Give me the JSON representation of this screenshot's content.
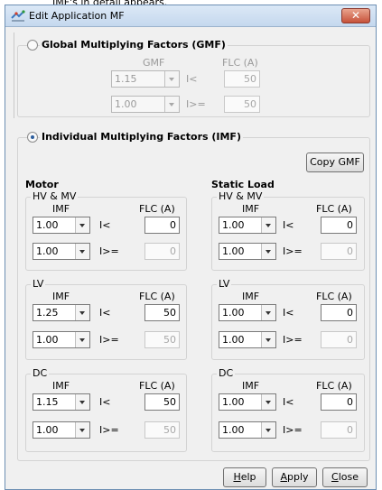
{
  "top_caption": "IMF's in detail appears.",
  "window": {
    "title": "Edit Application MF",
    "close_glyph": "✕"
  },
  "gmf_section": {
    "legend": "Global Multiplying Factors (GMF)",
    "col_gmf": "GMF",
    "col_flc": "FLC (A)",
    "rows": [
      {
        "value": "1.15",
        "op": "I<",
        "flc": "50"
      },
      {
        "value": "1.00",
        "op": "I>=",
        "flc": "50"
      }
    ]
  },
  "imf_section": {
    "legend": "Individual Multiplying Factors (IMF)",
    "copy_button": "Copy GMF"
  },
  "motor": {
    "heading": "Motor",
    "groups": [
      {
        "title": "HV & MV",
        "col_imf": "IMF",
        "col_flc": "FLC (A)",
        "rows": [
          {
            "value": "1.00",
            "op": "I<",
            "flc": "0"
          },
          {
            "value": "1.00",
            "op": "I>=",
            "flc": "0"
          }
        ]
      },
      {
        "title": "LV",
        "col_imf": "IMF",
        "col_flc": "FLC (A)",
        "rows": [
          {
            "value": "1.25",
            "op": "I<",
            "flc": "50"
          },
          {
            "value": "1.00",
            "op": "I>=",
            "flc": "50"
          }
        ]
      },
      {
        "title": "DC",
        "col_imf": "IMF",
        "col_flc": "FLC (A)",
        "rows": [
          {
            "value": "1.15",
            "op": "I<",
            "flc": "50"
          },
          {
            "value": "1.00",
            "op": "I>=",
            "flc": "50"
          }
        ]
      }
    ]
  },
  "static_load": {
    "heading": "Static Load",
    "groups": [
      {
        "title": "HV & MV",
        "col_imf": "IMF",
        "col_flc": "FLC (A)",
        "rows": [
          {
            "value": "1.00",
            "op": "I<",
            "flc": "0"
          },
          {
            "value": "1.00",
            "op": "I>=",
            "flc": "0"
          }
        ]
      },
      {
        "title": "LV",
        "col_imf": "IMF",
        "col_flc": "FLC (A)",
        "rows": [
          {
            "value": "1.00",
            "op": "I<",
            "flc": "0"
          },
          {
            "value": "1.00",
            "op": "I>=",
            "flc": "0"
          }
        ]
      },
      {
        "title": "DC",
        "col_imf": "IMF",
        "col_flc": "FLC (A)",
        "rows": [
          {
            "value": "1.00",
            "op": "I<",
            "flc": "0"
          },
          {
            "value": "1.00",
            "op": "I>=",
            "flc": "0"
          }
        ]
      }
    ]
  },
  "buttons": {
    "help_first": "H",
    "help_rest": "elp",
    "apply_first": "A",
    "apply_rest": "pply",
    "close_first": "C",
    "close_rest": "lose"
  }
}
